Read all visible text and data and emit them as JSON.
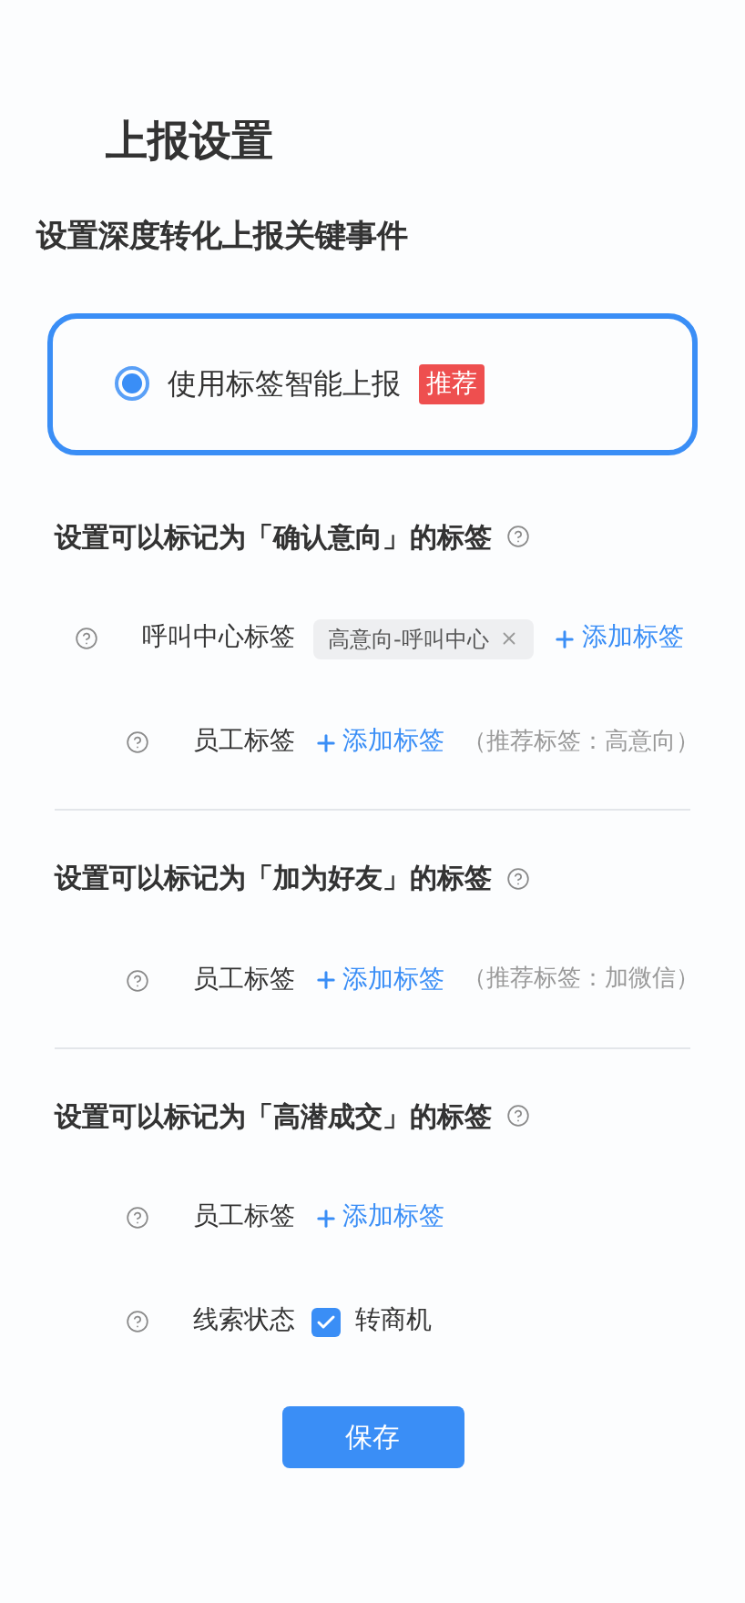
{
  "page_title": "上报设置",
  "subtitle": "设置深度转化上报关键事件",
  "option": {
    "label": "使用标签智能上报",
    "selected": true,
    "badge": "推荐"
  },
  "sections": [
    {
      "title": "设置可以标记为「确认意向」的标签",
      "rows": [
        {
          "kind": "tags",
          "label": "呼叫中心标签",
          "tags": [
            "高意向-呼叫中心"
          ],
          "add": "添加标签"
        },
        {
          "kind": "tags",
          "label": "员工标签",
          "add": "添加标签",
          "hint": "（推荐标签：高意向）"
        }
      ]
    },
    {
      "title": "设置可以标记为「加为好友」的标签",
      "rows": [
        {
          "kind": "tags",
          "label": "员工标签",
          "add": "添加标签",
          "hint": "（推荐标签：加微信）"
        }
      ]
    },
    {
      "title": "设置可以标记为「高潜成交」的标签",
      "rows": [
        {
          "kind": "tags",
          "label": "员工标签",
          "add": "添加标签"
        },
        {
          "kind": "checkbox",
          "label": "线索状态",
          "option": "转商机",
          "checked": true
        }
      ]
    }
  ],
  "save": "保存"
}
